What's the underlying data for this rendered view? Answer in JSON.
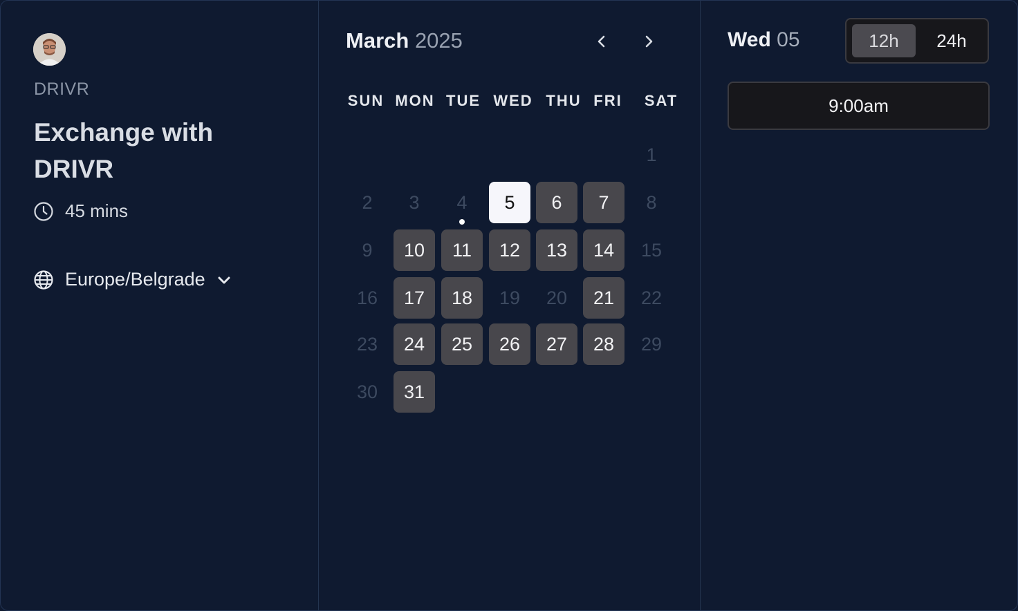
{
  "profile": {
    "org": "DRIVR",
    "event_title": "Exchange with DRIVR",
    "duration": "45 mins",
    "timezone": "Europe/Belgrade"
  },
  "calendar": {
    "month": "March",
    "year": "2025",
    "weekdays": [
      "SUN",
      "MON",
      "TUE",
      "WED",
      "THU",
      "FRI",
      "SAT"
    ],
    "days": {
      "d1": "1",
      "d2": "2",
      "d3": "3",
      "d4": "4",
      "d5": "5",
      "d6": "6",
      "d7": "7",
      "d8": "8",
      "d9": "9",
      "d10": "10",
      "d11": "11",
      "d12": "12",
      "d13": "13",
      "d14": "14",
      "d15": "15",
      "d16": "16",
      "d17": "17",
      "d18": "18",
      "d19": "19",
      "d20": "20",
      "d21": "21",
      "d22": "22",
      "d23": "23",
      "d24": "24",
      "d25": "25",
      "d26": "26",
      "d27": "27",
      "d28": "28",
      "d29": "29",
      "d30": "30",
      "d31": "31"
    },
    "available_days": [
      5,
      6,
      7,
      10,
      11,
      12,
      13,
      14,
      17,
      18,
      21,
      24,
      25,
      26,
      27,
      28,
      31
    ],
    "selected_day": 5,
    "today_day": 4
  },
  "schedule": {
    "day_name": "Wed",
    "day_number": "05",
    "format_12h": "12h",
    "format_24h": "24h",
    "active_format": "12h",
    "slots": [
      "9:00am"
    ]
  },
  "colors": {
    "background": "#0f1a30",
    "day_available": "#48474c",
    "day_selected": "#f6f6fb"
  }
}
